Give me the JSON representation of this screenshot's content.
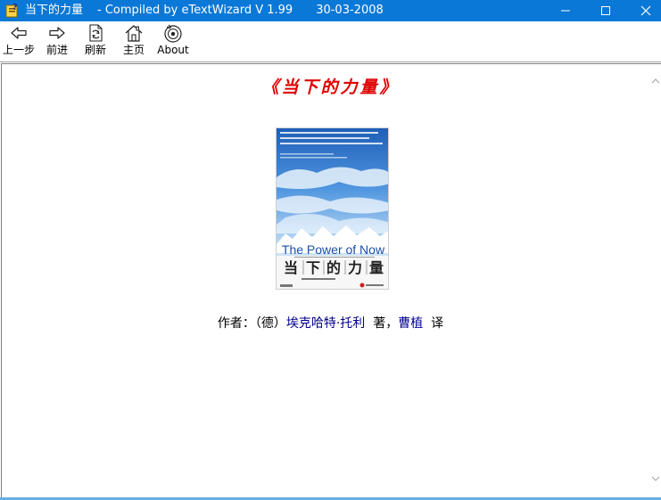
{
  "window": {
    "title": "当下的力量",
    "compiled_by": "- Compiled by eTextWizard V 1.99",
    "date": "30-03-2008",
    "accent_color": "#0a78d7"
  },
  "toolbar": {
    "back_label": "上一步",
    "forward_label": "前进",
    "refresh_label": "刷新",
    "home_label": "主页",
    "about_label": "About"
  },
  "content": {
    "book_title": "《当下的力量》",
    "cover": {
      "english_title": "The Power of Now",
      "chinese_title_chars": [
        "当",
        "下",
        "的",
        "力",
        "量"
      ]
    },
    "author_prefix": "作者：（德）",
    "author_name": "埃克哈特·托利",
    "author_suffix": "著，",
    "translator_name": "曹植",
    "translator_suffix": "译",
    "title_color": "#e00000",
    "link_color": "#00008b"
  }
}
